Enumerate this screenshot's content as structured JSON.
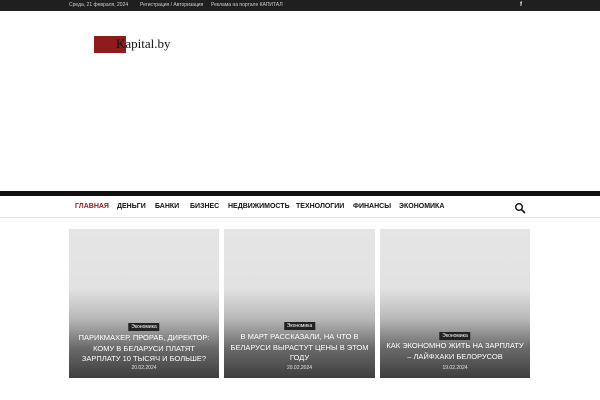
{
  "topbar": {
    "date": "Среда, 21 февраля, 2024",
    "login_link": "Регистрация / Авторизация",
    "ads_link": "Реклама на портале КАПИТАЛ",
    "facebook_icon": "f"
  },
  "logo": {
    "text": "Kapital.by",
    "mark_color": "#8e1c1c"
  },
  "nav": {
    "items": [
      "ГЛАВНАЯ",
      "ДЕНЬГИ",
      "БАНКИ",
      "БИЗНЕС",
      "НЕДВИЖИМОСТЬ",
      "ТЕХНОЛОГИИ",
      "ФИНАНСЫ",
      "ЭКОНОМИКА"
    ],
    "active": "ГЛАВНАЯ",
    "search_icon": "search-icon"
  },
  "cards": [
    {
      "tag": "Экономика",
      "title": "ПАРИКМАХЕР, ПРОРАБ, ДИРЕКТОР: КОМУ В БЕЛАРУСИ ПЛАТЯТ ЗАРПЛАТУ 10 ТЫСЯЧ И БОЛЬШЕ?",
      "date": "20.02.2024"
    },
    {
      "tag": "Экономика",
      "title": "В МАРТ РАССКАЗАЛИ, НА ЧТО В БЕЛАРУСИ ВЫРАСТУТ ЦЕНЫ В ЭТОМ ГОДУ",
      "date": "20.02.2024"
    },
    {
      "tag": "Экономика",
      "title": "КАК ЭКОНОМНО ЖИТЬ НА ЗАРПЛАТУ – ЛАЙФХАКИ БЕЛОРУСОВ",
      "date": "19.02.2024"
    }
  ],
  "colors": {
    "accent": "#8e1c1c",
    "topbar_bg": "#1f1f1f"
  }
}
